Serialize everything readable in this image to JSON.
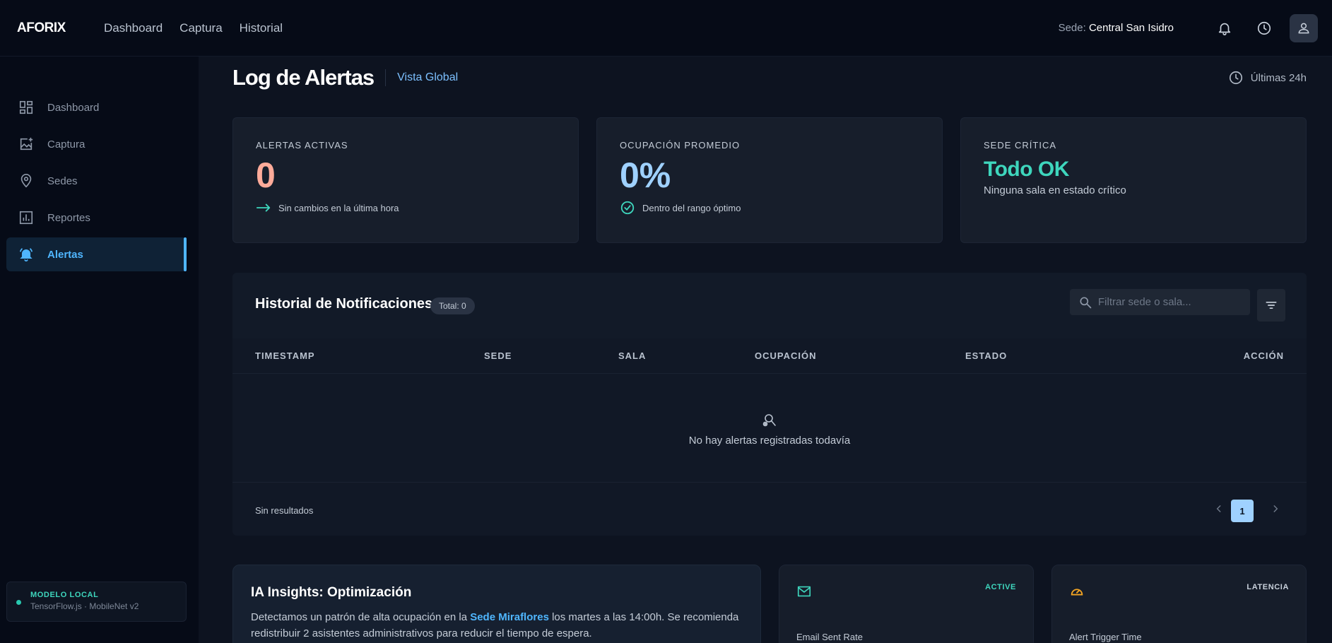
{
  "header": {
    "logo": "AFORIX",
    "nav": [
      "Dashboard",
      "Captura",
      "Historial"
    ],
    "sede_prefix": "Sede:",
    "sede_name": "Central San Isidro"
  },
  "sidebar": {
    "items": [
      {
        "label": "Dashboard",
        "icon": "dashboard-icon"
      },
      {
        "label": "Captura",
        "icon": "add-photo-icon"
      },
      {
        "label": "Sedes",
        "icon": "location-pin-icon"
      },
      {
        "label": "Reportes",
        "icon": "bar-chart-icon"
      },
      {
        "label": "Alertas",
        "icon": "alarm-bell-icon",
        "active": true
      }
    ],
    "model_title": "MODELO LOCAL",
    "model_sub": "TensorFlow.js · MobileNet v2"
  },
  "page": {
    "title": "Log de Alertas",
    "subtitle": "Vista Global",
    "time_range": "Últimas 24h"
  },
  "stats": {
    "active": {
      "label": "ALERTAS ACTIVAS",
      "value": "0",
      "note": "Sin cambios en la última hora"
    },
    "occupancy": {
      "label": "OCUPACIÓN PROMEDIO",
      "value": "0%",
      "note": "Dentro del rango óptimo"
    },
    "critical": {
      "label": "SEDE CRÍTICA",
      "value": "Todo OK",
      "note": "Ninguna sala en estado crítico"
    }
  },
  "history": {
    "title": "Historial de Notificaciones",
    "badge": "Total: 0",
    "search_placeholder": "Filtrar sede o sala...",
    "columns": [
      "TIMESTAMP",
      "SEDE",
      "SALA",
      "OCUPACIÓN",
      "ESTADO",
      "ACCIÓN"
    ],
    "empty_text": "No hay alertas registradas todavía",
    "footer_text": "Sin resultados",
    "current_page": "1"
  },
  "insight": {
    "title": "IA Insights: Optimización",
    "text_before": "Detectamos un patrón de alta ocupación en la ",
    "highlight": "Sede Miraflores",
    "text_after": " los martes a las 14:00h. Se recomienda redistribuir 2 asistentes administrativos para reducir el tiempo de espera."
  },
  "cards": {
    "email": {
      "badge": "ACTIVE",
      "label": "Email Sent Rate",
      "icon": "mail-icon"
    },
    "latency": {
      "badge": "LATENCIA",
      "label": "Alert Trigger Time",
      "icon": "speedometer-icon"
    }
  },
  "colors": {
    "accent": "#4fb6ff",
    "teal": "#3ed6bd",
    "salmon": "#ffab9a",
    "amber": "#f5a623"
  }
}
